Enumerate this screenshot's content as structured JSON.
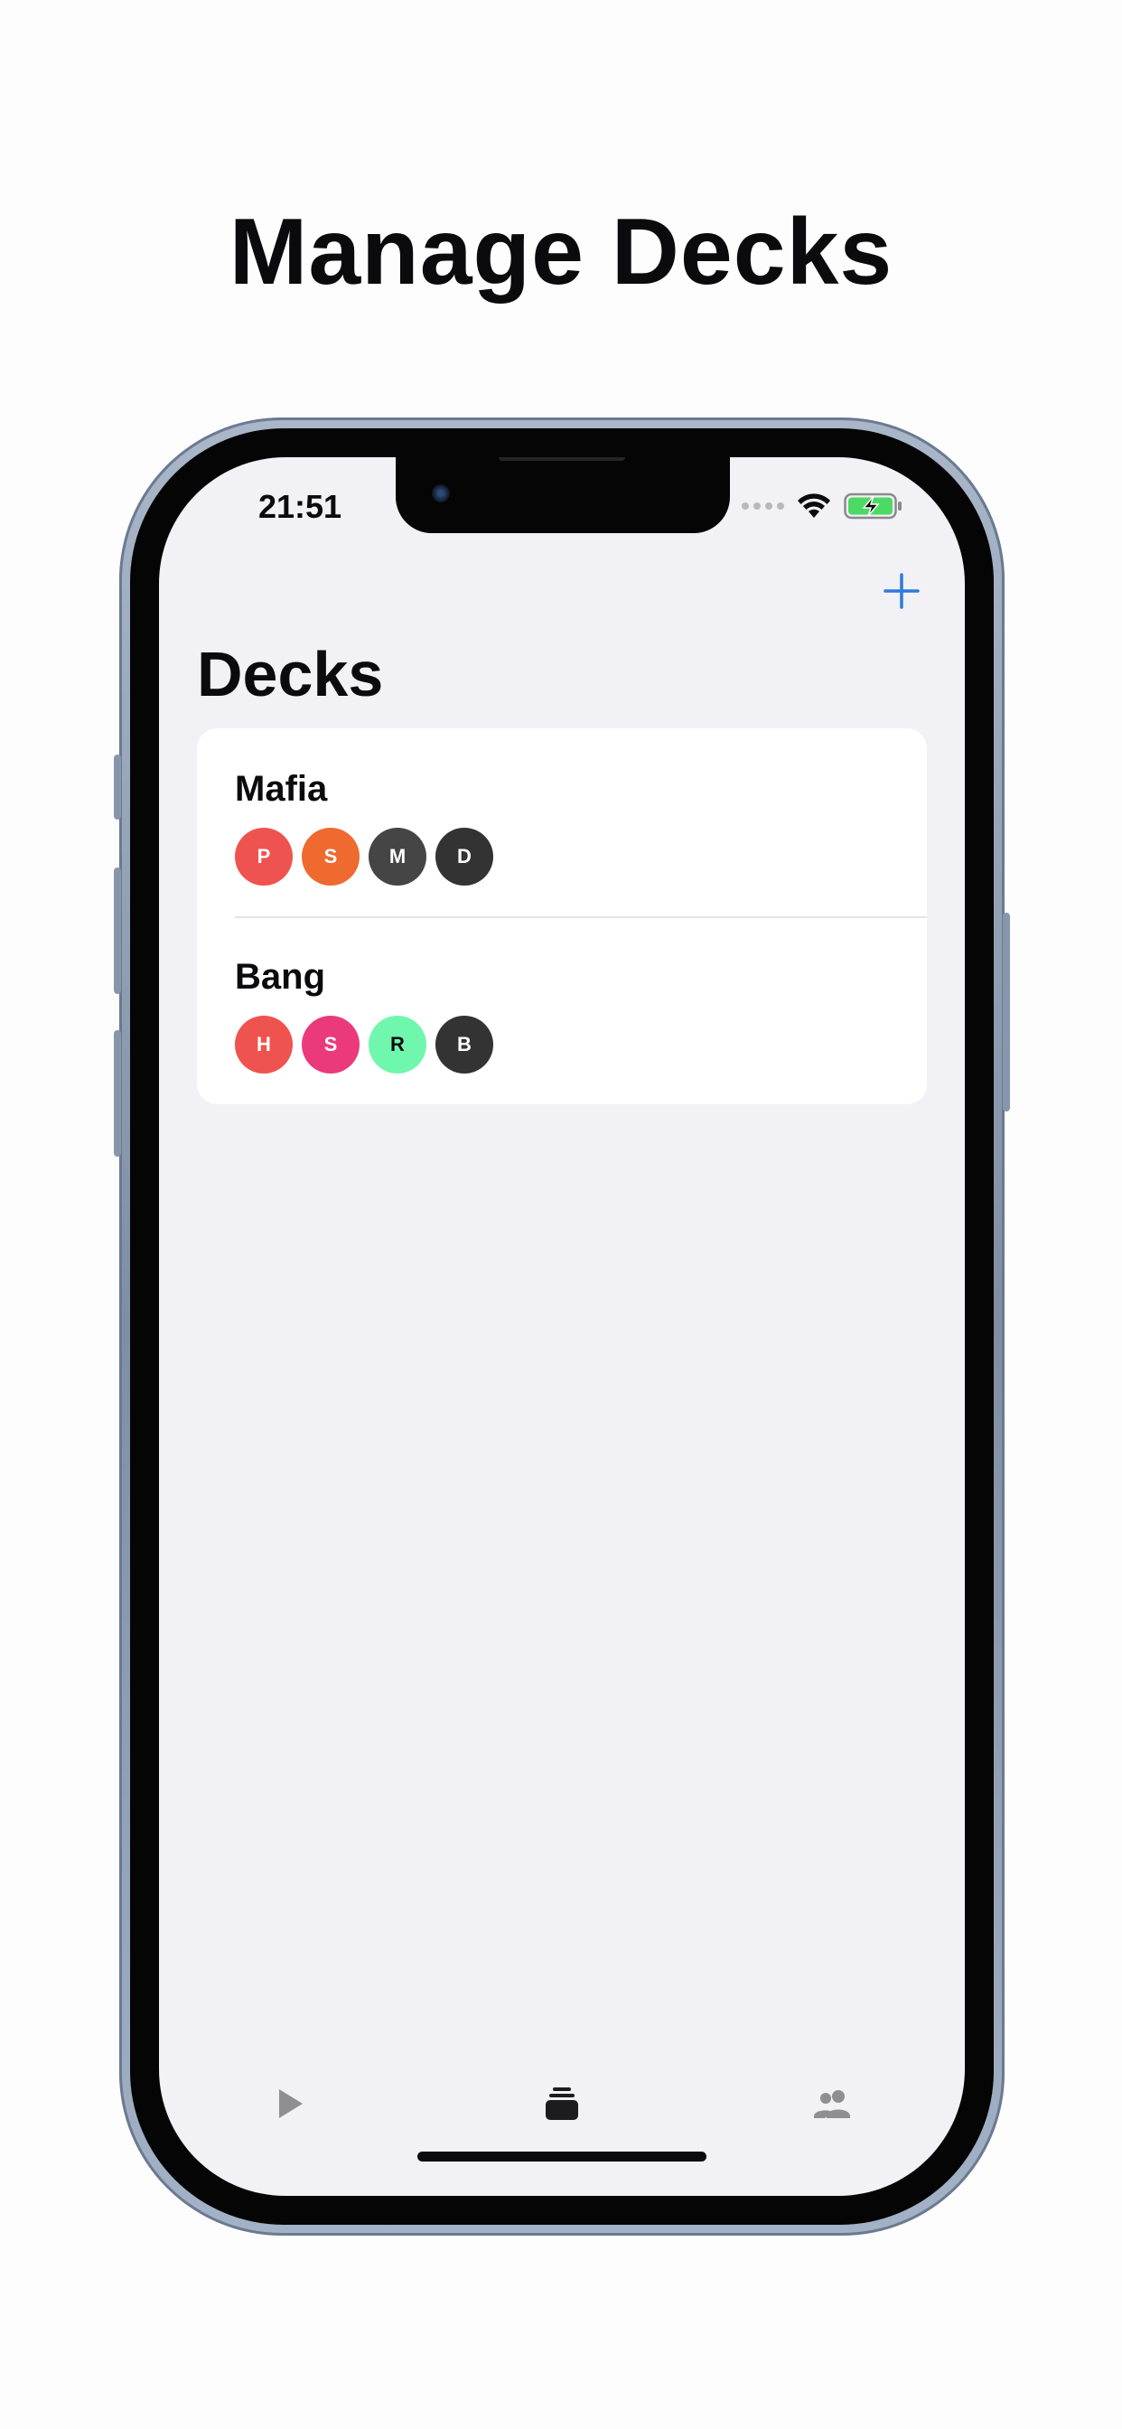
{
  "headline": "Manage Decks",
  "status_bar": {
    "time": "21:51",
    "icons": [
      "signal-dots-icon",
      "wifi-icon",
      "battery-charging-icon"
    ]
  },
  "nav": {
    "title": "Decks",
    "add_icon": "plus-icon"
  },
  "decks": [
    {
      "name": "Mafia",
      "roles": [
        {
          "letter": "P",
          "color": "#ef5350",
          "text_color": "#ffffff"
        },
        {
          "letter": "S",
          "color": "#ee6a2f",
          "text_color": "#ffffff"
        },
        {
          "letter": "M",
          "color": "#454545",
          "text_color": "#ffffff"
        },
        {
          "letter": "D",
          "color": "#333333",
          "text_color": "#ffffff"
        }
      ]
    },
    {
      "name": "Bang",
      "roles": [
        {
          "letter": "H",
          "color": "#ef5350",
          "text_color": "#ffffff"
        },
        {
          "letter": "S",
          "color": "#ea3a7c",
          "text_color": "#ffffff"
        },
        {
          "letter": "R",
          "color": "#6ff7ae",
          "text_color": "#0b0b0d"
        },
        {
          "letter": "B",
          "color": "#333333",
          "text_color": "#ffffff"
        }
      ]
    }
  ],
  "tab_bar": {
    "tabs": [
      {
        "icon": "play-icon",
        "selected": false
      },
      {
        "icon": "card-stack-icon",
        "selected": true
      },
      {
        "icon": "people-icon",
        "selected": false
      }
    ]
  },
  "colors": {
    "accent": "#2f7bd9",
    "tab_inactive": "#8e8e93",
    "tab_active": "#1c1c1e",
    "screen_bg": "#f1f1f6"
  }
}
